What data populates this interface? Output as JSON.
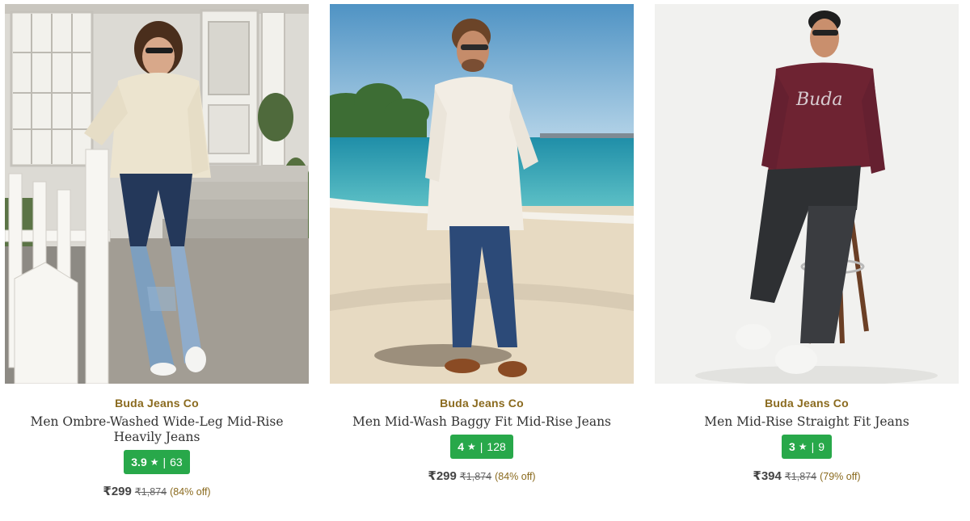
{
  "products": [
    {
      "brand": "Buda Jeans Co",
      "title": "Men Ombre-Washed Wide-Leg Mid-Rise Heavily Jeans",
      "rating": "3.9",
      "rating_count": "63",
      "price": "₹299",
      "mrp": "₹1,874",
      "discount": "(84% off)",
      "image": "model-cream-sweater-ombre-jeans-porch"
    },
    {
      "brand": "Buda Jeans Co",
      "title": "Men Mid-Wash Baggy Fit Mid-Rise Jeans",
      "rating": "4",
      "rating_count": "128",
      "price": "₹299",
      "mrp": "₹1,874",
      "discount": "(84% off)",
      "image": "model-white-shirt-blue-jeans-beach"
    },
    {
      "brand": "Buda Jeans Co",
      "title": "Men Mid-Rise Straight Fit Jeans",
      "rating": "3",
      "rating_count": "9",
      "price": "₹394",
      "mrp": "₹1,874",
      "discount": "(79% off)",
      "image": "model-maroon-tee-black-jeans-stool"
    }
  ],
  "ui": {
    "star_glyph": "★",
    "separator": "|"
  },
  "colors": {
    "brand_text": "#8a6a1e",
    "rating_bg": "#28a84a",
    "discount_text": "#8a6a1e"
  }
}
